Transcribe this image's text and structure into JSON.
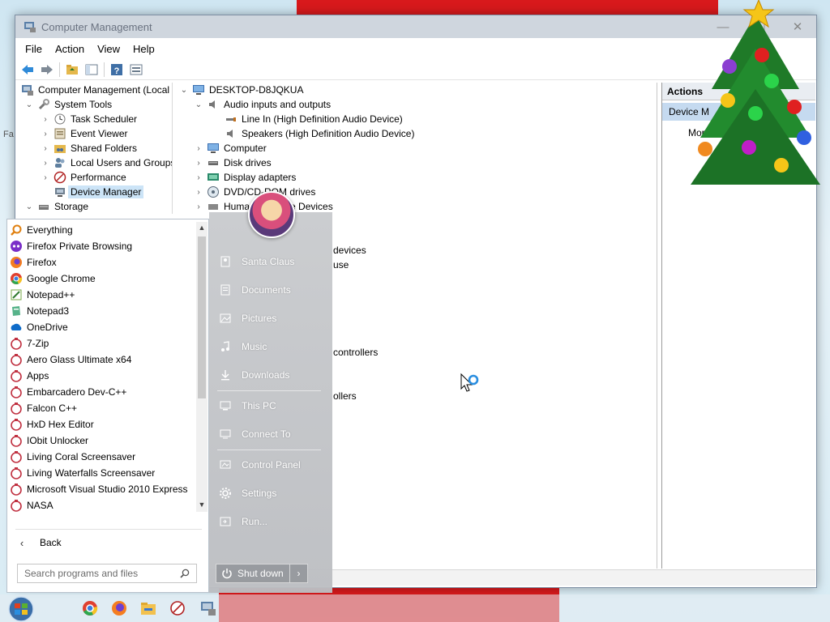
{
  "window": {
    "title": "Computer Management",
    "minimize": "—",
    "maximize": "☐",
    "close": "✕"
  },
  "menu": [
    "File",
    "Action",
    "View",
    "Help"
  ],
  "left_tree": {
    "root": "Computer Management (Local",
    "system_tools": "System Tools",
    "children": [
      "Task Scheduler",
      "Event Viewer",
      "Shared Folders",
      "Local Users and Groups",
      "Performance",
      "Device Manager"
    ],
    "storage": "Storage"
  },
  "device_tree": {
    "computer_name": "DESKTOP-D8JQKUA",
    "audio": {
      "label": "Audio inputs and outputs",
      "children": [
        "Line In (High Definition Audio Device)",
        "Speakers (High Definition Audio Device)"
      ]
    },
    "categories": [
      "Computer",
      "Disk drives",
      "Display adapters",
      "DVD/CD-ROM drives",
      "Human Interface Devices"
    ],
    "fragments": [
      "devices",
      "use",
      "controllers",
      "ollers"
    ]
  },
  "actions_pane": {
    "header": "Actions",
    "section": "Device M",
    "more": "More"
  },
  "start_menu": {
    "programs": [
      "Everything",
      "Firefox Private Browsing",
      "Firefox",
      "Google Chrome",
      "Notepad++",
      "Notepad3",
      "OneDrive",
      "7-Zip",
      "Aero Glass Ultimate x64",
      "Apps",
      "Embarcadero Dev-C++",
      "Falcon C++",
      "HxD Hex Editor",
      "IObit Unlocker",
      "Living Coral Screensaver",
      "Living Waterfalls Screensaver",
      "Microsoft Visual Studio 2010 Express",
      "NASA"
    ],
    "back": "Back",
    "search_placeholder": "Search programs and files",
    "places": [
      "Santa Claus",
      "Documents",
      "Pictures",
      "Music",
      "Downloads",
      "This PC",
      "Connect To",
      "Control Panel",
      "Settings",
      "Run..."
    ],
    "shutdown": "Shut down"
  },
  "colors": {
    "accent": "#0078d7",
    "selection": "#cce4f7",
    "wallpaper_red": "#d8191c"
  }
}
